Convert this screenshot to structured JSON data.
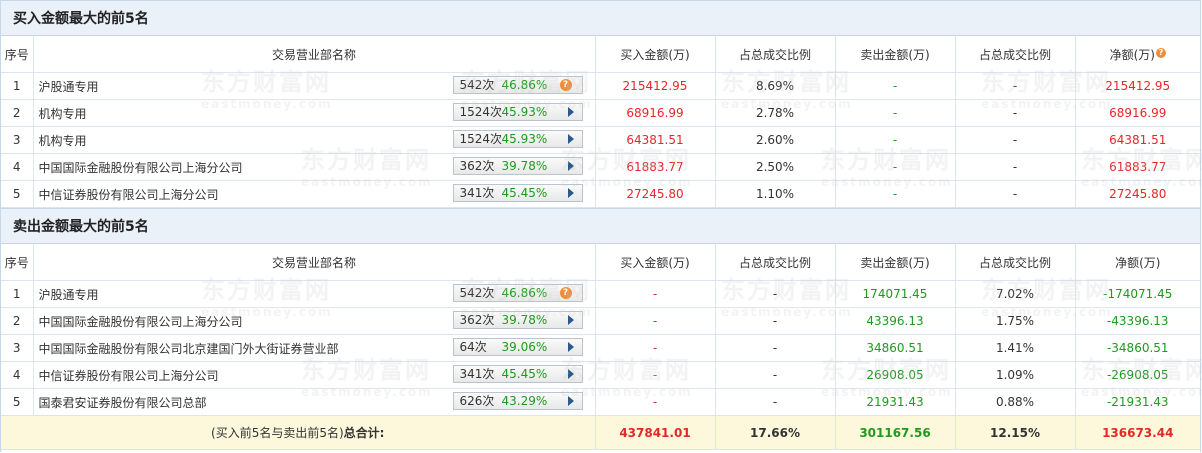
{
  "buy_section": {
    "title": "买入金额最大的前5名",
    "headers": {
      "num": "序号",
      "name": "交易营业部名称",
      "buy": "买入金额(万)",
      "pct1": "占总成交比例",
      "sell": "卖出金额(万)",
      "pct2": "占总成交比例",
      "net": "净额(万)"
    },
    "rows": [
      {
        "num": "1",
        "name": "沪股通专用",
        "count": "542次",
        "rate": "46.86%",
        "badge_icon": "question-icon",
        "buy": "215412.95",
        "pct1": "8.69%",
        "sell": "-",
        "pct2": "-",
        "net": "215412.95"
      },
      {
        "num": "2",
        "name": "机构专用",
        "count": "1524次",
        "rate": "45.93%",
        "badge_icon": "arrow-right-icon",
        "buy": "68916.99",
        "pct1": "2.78%",
        "sell": "-",
        "pct2": "-",
        "net": "68916.99"
      },
      {
        "num": "3",
        "name": "机构专用",
        "count": "1524次",
        "rate": "45.93%",
        "badge_icon": "arrow-right-icon",
        "buy": "64381.51",
        "pct1": "2.60%",
        "sell": "-",
        "pct2": "-",
        "net": "64381.51"
      },
      {
        "num": "4",
        "name": "中国国际金融股份有限公司上海分公司",
        "count": "362次",
        "rate": "39.78%",
        "badge_icon": "arrow-right-icon",
        "buy": "61883.77",
        "pct1": "2.50%",
        "sell": "-",
        "pct2": "-",
        "net": "61883.77"
      },
      {
        "num": "5",
        "name": "中信证券股份有限公司上海分公司",
        "count": "341次",
        "rate": "45.45%",
        "badge_icon": "arrow-right-icon",
        "buy": "27245.80",
        "pct1": "1.10%",
        "sell": "-",
        "pct2": "-",
        "net": "27245.80"
      }
    ]
  },
  "sell_section": {
    "title": "卖出金额最大的前5名",
    "headers": {
      "num": "序号",
      "name": "交易营业部名称",
      "buy": "买入金额(万)",
      "pct1": "占总成交比例",
      "sell": "卖出金额(万)",
      "pct2": "占总成交比例",
      "net": "净额(万)"
    },
    "rows": [
      {
        "num": "1",
        "name": "沪股通专用",
        "count": "542次",
        "rate": "46.86%",
        "badge_icon": "question-icon",
        "buy": "-",
        "pct1": "-",
        "sell": "174071.45",
        "pct2": "7.02%",
        "net": "-174071.45"
      },
      {
        "num": "2",
        "name": "中国国际金融股份有限公司上海分公司",
        "count": "362次",
        "rate": "39.78%",
        "badge_icon": "arrow-right-icon",
        "buy": "-",
        "pct1": "-",
        "sell": "43396.13",
        "pct2": "1.75%",
        "net": "-43396.13"
      },
      {
        "num": "3",
        "name": "中国国际金融股份有限公司北京建国门外大街证券营业部",
        "count": "64次",
        "rate": "39.06%",
        "badge_icon": "arrow-right-icon",
        "buy": "-",
        "pct1": "-",
        "sell": "34860.51",
        "pct2": "1.41%",
        "net": "-34860.51"
      },
      {
        "num": "4",
        "name": "中信证券股份有限公司上海分公司",
        "count": "341次",
        "rate": "45.45%",
        "badge_icon": "arrow-right-icon",
        "buy": "-",
        "pct1": "-",
        "sell": "26908.05",
        "pct2": "1.09%",
        "net": "-26908.05"
      },
      {
        "num": "5",
        "name": "国泰君安证券股份有限公司总部",
        "count": "626次",
        "rate": "43.29%",
        "badge_icon": "arrow-right-icon",
        "buy": "-",
        "pct1": "-",
        "sell": "21931.43",
        "pct2": "0.88%",
        "net": "-21931.43"
      }
    ]
  },
  "total": {
    "label_prefix": "(买入前5名与卖出前5名)",
    "label_bold": "总合计:",
    "buy": "437841.01",
    "pct1": "17.66%",
    "sell": "301167.56",
    "pct2": "12.15%",
    "net": "136673.44"
  },
  "watermark": {
    "cn": "东方财富网",
    "en": "eastmoney.com"
  },
  "colors": {
    "buy": "#e32828",
    "sell": "#1e9a1e",
    "header_bg": "#eaf1f8",
    "total_bg": "#fdf8dc",
    "badge_rate": "#1e9a1e",
    "question_icon": "#ef8d3b"
  }
}
